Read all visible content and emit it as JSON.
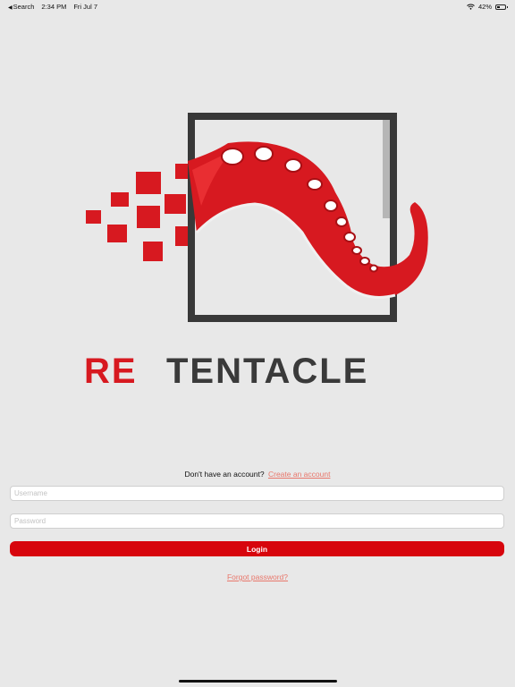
{
  "status_bar": {
    "back_label": "Search",
    "time": "2:34 PM",
    "date": "Fri Jul 7",
    "battery": "42%",
    "battery_level": 0.42,
    "icons": [
      "back-arrow-icon",
      "wifi-icon",
      "battery-icon"
    ]
  },
  "logo": {
    "wordmark_red": "RE",
    "wordmark_dark": "TENTACLE",
    "colors": {
      "red": "#d71920",
      "dark": "#3a3a3a"
    }
  },
  "signup": {
    "prompt": "Don't have an account?",
    "link_label": "Create an account"
  },
  "form": {
    "username_placeholder": "Username",
    "username_value": "",
    "password_placeholder": "Password",
    "password_value": "",
    "login_label": "Login",
    "forgot_label": "Forgot password?"
  },
  "colors": {
    "background": "#e8e8e8",
    "accent": "#d7050d",
    "link": "#e8776b"
  }
}
